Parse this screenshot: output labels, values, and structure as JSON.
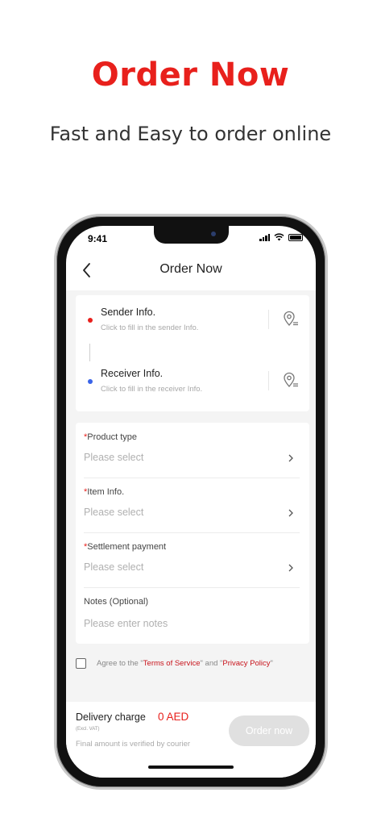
{
  "promo": {
    "title": "Order Now",
    "subtitle": "Fast and Easy to order online"
  },
  "status_bar": {
    "time": "9:41"
  },
  "nav": {
    "title": "Order Now",
    "back_icon": "chevron-left-icon"
  },
  "address": {
    "sender": {
      "title": "Sender Info.",
      "hint": "Click to fill in the sender Info.",
      "icon": "location-pin-icon"
    },
    "receiver": {
      "title": "Receiver Info.",
      "hint": "Click to fill in the receiver Info.",
      "icon": "location-pin-icon"
    }
  },
  "form": {
    "required_mark": "*",
    "product_type": {
      "label": "Product type",
      "placeholder": "Please select"
    },
    "item_info": {
      "label": "Item Info.",
      "placeholder": "Please select"
    },
    "settlement": {
      "label": "Settlement payment",
      "placeholder": "Please select"
    },
    "notes": {
      "label": "Notes (Optional)",
      "placeholder": "Please enter notes"
    }
  },
  "agreement": {
    "prefix": "Agree to the \"",
    "terms": "Terms of Service",
    "middle": "\" and \"",
    "privacy": "Privacy Policy",
    "suffix": "\""
  },
  "footer": {
    "charge_label": "Delivery charge",
    "charge_value": "0 AED",
    "vat_note": "(Excl. VAT)",
    "final_note": "Final amount is verified by courier",
    "order_button": "Order now"
  },
  "colors": {
    "brand_red": "#e8201c",
    "sender_dot": "#e8201c",
    "receiver_dot": "#3a64e8",
    "disabled_button": "#e0e0e0"
  }
}
